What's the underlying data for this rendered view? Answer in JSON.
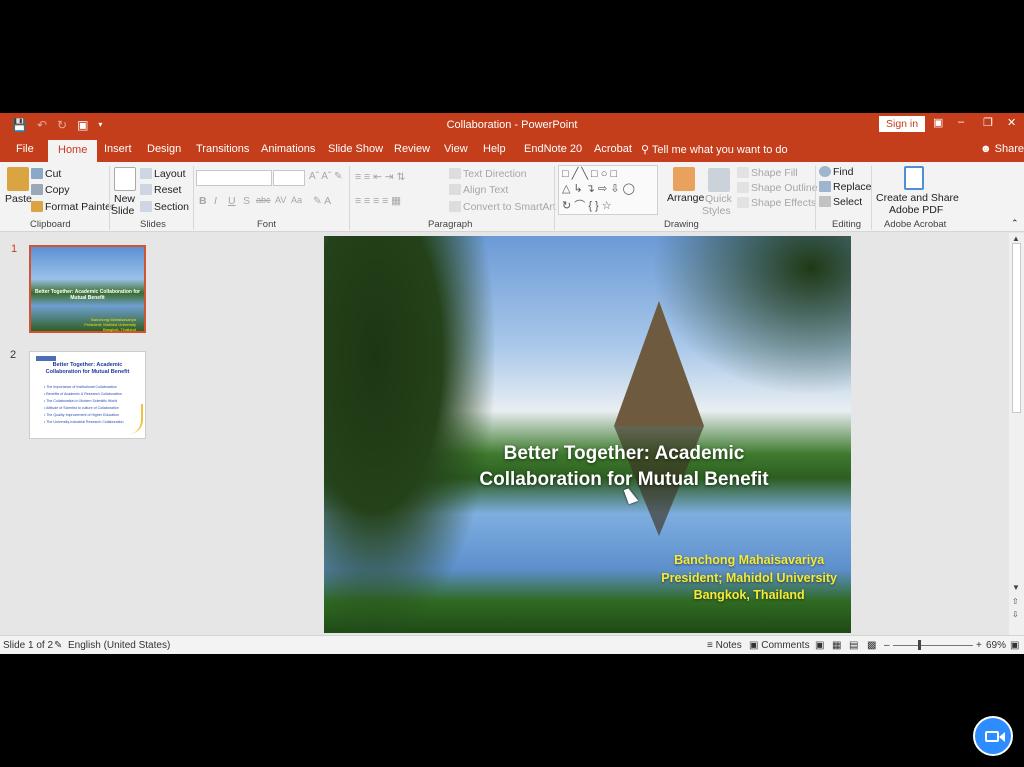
{
  "window": {
    "title": "Collaboration  -  PowerPoint",
    "sign_in": "Sign in"
  },
  "tabs": [
    "File",
    "Home",
    "Insert",
    "Design",
    "Transitions",
    "Animations",
    "Slide Show",
    "Review",
    "View",
    "Help",
    "EndNote 20",
    "Acrobat"
  ],
  "tell_me": "Tell me what you want to do",
  "share": "Share",
  "ribbon": {
    "clipboard": {
      "paste": "Paste",
      "cut": "Cut",
      "copy": "Copy",
      "format_painter": "Format Painter",
      "label": "Clipboard"
    },
    "slides": {
      "new_slide_1": "New",
      "new_slide_2": "Slide",
      "layout": "Layout",
      "reset": "Reset",
      "section": "Section",
      "label": "Slides"
    },
    "font": {
      "label": "Font",
      "bold": "B",
      "italic": "I",
      "underline": "U",
      "shadow": "S",
      "strike": "abc",
      "spacing": "AV",
      "case": "Aa"
    },
    "paragraph": {
      "text_direction": "Text Direction",
      "align_text": "Align Text",
      "convert": "Convert to SmartArt",
      "label": "Paragraph"
    },
    "drawing": {
      "arrange": "Arrange",
      "quick_1": "Quick",
      "quick_2": "Styles",
      "shape_fill": "Shape Fill",
      "shape_outline": "Shape Outline",
      "shape_effects": "Shape Effects",
      "label": "Drawing"
    },
    "editing": {
      "find": "Find",
      "replace": "Replace",
      "select": "Select",
      "label": "Editing"
    },
    "acrobat": {
      "create_1": "Create and Share",
      "create_2": "Adobe PDF",
      "label": "Adobe Acrobat"
    }
  },
  "thumbnails": [
    {
      "number": "1",
      "title": "Better Together: Academic Collaboration for Mutual Benefit",
      "sub": [
        "Banchong Mahaisavariya",
        "President; Mahidol University",
        "Bangkok, Thailand"
      ]
    },
    {
      "number": "2",
      "title_1": "Better Together: Academic",
      "title_2": "Collaboration for Mutual Benefit",
      "items": [
        "• The Importance of Institutional Collaboration",
        "• Benefits of Academic & Research Collaboration",
        "• The Collaboration in Modern Scientific World",
        "• Attitude of Scientist to culture of Collaboration",
        "• The Quality Improvement of Higher Education",
        "• The University-Industrial Research Collaboration"
      ]
    }
  ],
  "slide": {
    "title_line1": "Better Together: Academic",
    "title_line2": "Collaboration for Mutual Benefit",
    "presenter": "Banchong Mahaisavariya",
    "role": "President; Mahidol University",
    "location": "Bangkok, Thailand"
  },
  "status": {
    "slide_info": "Slide 1 of 2",
    "language": "English (United States)",
    "notes": "Notes",
    "comments": "Comments",
    "zoom": "69%",
    "zoom_level_percent": 69
  },
  "colors": {
    "accent": "#c43e1c",
    "slide_subtitle": "#f7ea32",
    "zoom_button": "#2d8cff"
  }
}
